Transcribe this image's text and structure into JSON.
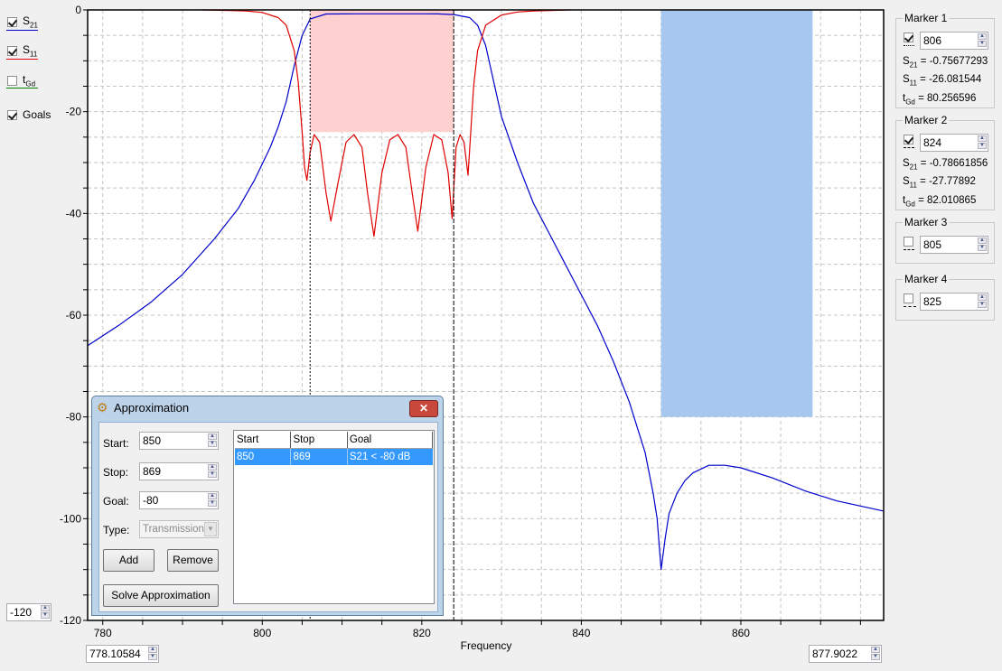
{
  "legend": {
    "items": [
      {
        "label": "S",
        "sub": "21",
        "checked": true,
        "color": "#0000cc"
      },
      {
        "label": "S",
        "sub": "11",
        "checked": true,
        "color": "#e00000"
      },
      {
        "label": "t",
        "sub": "Gd",
        "checked": false,
        "color": "#008000"
      },
      {
        "label": "Goals",
        "sub": "",
        "checked": true
      }
    ]
  },
  "axis_controls": {
    "y_min": "-120",
    "x_min": "778.10584",
    "x_max": "877.9022"
  },
  "markers": [
    {
      "title": "Marker 1",
      "checked": true,
      "value": "806",
      "style": "dotted",
      "s21": "-0.75677293",
      "s11": "-26.081544",
      "tgd": "80.256596"
    },
    {
      "title": "Marker 2",
      "checked": true,
      "value": "824",
      "style": "dash-dot",
      "s21": "-0.78661856",
      "s11": "-27.77892",
      "tgd": "82.010865"
    },
    {
      "title": "Marker 3",
      "checked": false,
      "value": "805",
      "style": "dash-dot-short"
    },
    {
      "title": "Marker 4",
      "checked": false,
      "value": "825",
      "style": "dashed"
    }
  ],
  "marker_labels": {
    "s21": "S",
    "s21_sub": "21",
    "s11": "S",
    "s11_sub": "11",
    "tgd": "t",
    "tgd_sub": "Gd"
  },
  "dialog": {
    "title": "Approximation",
    "close_label": "✕",
    "start_label": "Start:",
    "start_value": "850",
    "stop_label": "Stop:",
    "stop_value": "869",
    "goal_label": "Goal:",
    "goal_value": "-80",
    "type_label": "Type:",
    "type_value": "Transmission",
    "add_label": "Add",
    "remove_label": "Remove",
    "solve_label": "Solve Approximation",
    "table": {
      "columns": [
        "Start",
        "Stop",
        "Goal"
      ],
      "rows": [
        [
          "850",
          "869",
          "S21 < -80 dB"
        ]
      ]
    }
  },
  "chart_data": {
    "type": "line",
    "title": "",
    "xlabel": "Frequency",
    "ylabel": "",
    "xlim": [
      778.10584,
      877.9022
    ],
    "ylim": [
      -120,
      0
    ],
    "x_ticks": [
      780,
      800,
      820,
      840,
      860
    ],
    "x_minor_step": 5,
    "y_ticks": [
      0,
      -20,
      -40,
      -60,
      -80,
      -100,
      -120
    ],
    "y_minor_step": 5,
    "grid": true,
    "series": [
      {
        "name": "S21",
        "color": "#0000cc",
        "x": [
          778.1,
          782,
          786,
          790,
          794,
          797,
          799,
          801,
          802,
          803,
          804,
          805,
          806,
          808,
          812,
          816,
          820,
          822,
          824,
          826,
          827,
          828,
          829,
          830,
          832,
          834,
          836,
          838,
          840,
          842,
          844,
          846,
          847,
          848,
          849,
          849.5,
          850,
          850.5,
          851,
          852,
          853,
          854,
          856,
          858,
          860,
          864,
          868,
          872,
          877.9
        ],
        "y": [
          -66,
          -62,
          -57.5,
          -52,
          -45,
          -39,
          -33.5,
          -27,
          -23,
          -18,
          -11,
          -5,
          -1.8,
          -0.8,
          -0.76,
          -0.76,
          -0.77,
          -0.78,
          -0.9,
          -1.5,
          -3,
          -7,
          -14,
          -21,
          -30,
          -38,
          -44,
          -50,
          -56,
          -62,
          -69,
          -77,
          -82,
          -87,
          -95,
          -100,
          -110,
          -104,
          -99,
          -95,
          -92.5,
          -91,
          -89.5,
          -89.5,
          -90,
          -92,
          -94.5,
          -96.5,
          -98.5
        ]
      },
      {
        "name": "S11",
        "color": "#e00000",
        "x": [
          792.4,
          798,
          800,
          802,
          803,
          804,
          804.5,
          805,
          805.3,
          805.6,
          806,
          806.5,
          807.2,
          808,
          808.6,
          809.5,
          810.5,
          811.5,
          812.5,
          813.2,
          814,
          815,
          816,
          817,
          818,
          818.8,
          819.5,
          820.5,
          821.5,
          822.5,
          823.3,
          823.8,
          824.3,
          824.8,
          825.3,
          825.8,
          826.5,
          827,
          828,
          830,
          832,
          834,
          838.6
        ],
        "y": [
          0,
          -0.2,
          -0.5,
          -1.5,
          -3,
          -8,
          -14,
          -24,
          -31,
          -33.5,
          -28,
          -24.5,
          -26,
          -36,
          -41.5,
          -34,
          -26,
          -24.5,
          -27,
          -36,
          -44.5,
          -32,
          -25.5,
          -24.5,
          -27,
          -36,
          -43.5,
          -31,
          -24.5,
          -25.5,
          -32,
          -41,
          -27,
          -24.5,
          -26,
          -32.5,
          -15,
          -8,
          -3,
          -1,
          -0.4,
          -0.2,
          0
        ]
      }
    ],
    "goals": [
      {
        "name": "passband-reflection-goal",
        "x_start": 806,
        "x_end": 824,
        "y_top": 0,
        "y_bottom": -24,
        "color": "#ffd0d0"
      },
      {
        "name": "stopband-goal",
        "x_start": 850,
        "x_end": 869,
        "y_top": 0,
        "y_bottom": -80,
        "color": "#a6c8ee"
      }
    ],
    "marker_lines": [
      {
        "x": 806,
        "style": "dotted"
      },
      {
        "x": 824,
        "style": "dash-dot"
      }
    ]
  }
}
